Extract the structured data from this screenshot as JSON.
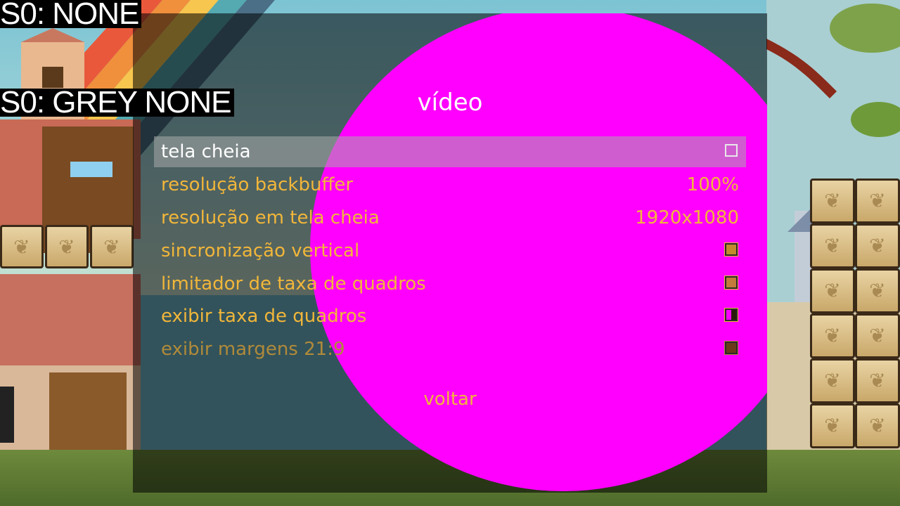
{
  "debug": {
    "line1": "S0: NONE",
    "line2": "S0: GREY NONE"
  },
  "menu": {
    "title": "vídeo",
    "items": [
      {
        "label": "tela cheia",
        "type": "checkbox",
        "checked": false,
        "selected": true
      },
      {
        "label": "resolução backbuffer",
        "type": "value",
        "value": "100%"
      },
      {
        "label": "resolução em tela cheia",
        "type": "value",
        "value": "1920x1080"
      },
      {
        "label": "sincronização vertical",
        "type": "checkbox",
        "checked": true
      },
      {
        "label": "limitador de taxa de quadros",
        "type": "checkbox",
        "checked": true
      },
      {
        "label": "exibir taxa de quadros",
        "type": "checkbox",
        "checked": true
      },
      {
        "label": "exibir margens 21:9",
        "type": "checkbox",
        "checked": true
      }
    ],
    "back_label": "voltar"
  },
  "colors": {
    "accent": "#f1b63a",
    "selected_text": "#ffffff",
    "overlay": "#ff00ff"
  }
}
